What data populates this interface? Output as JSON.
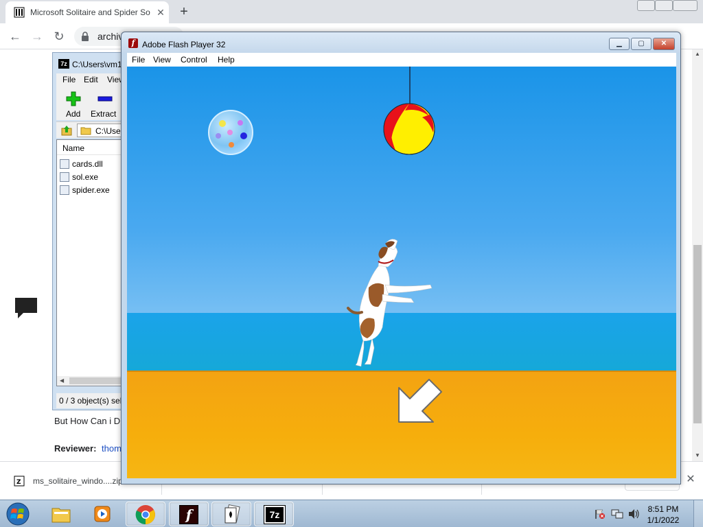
{
  "browser": {
    "tab_title": "Microsoft Solitaire and Spider So",
    "tab_close": "✕",
    "new_tab": "+",
    "omnibox_text": "archiv",
    "page": {
      "question_text": "But How Can i D",
      "reviewer_label": "Reviewer:",
      "reviewer_link": "thom"
    },
    "download_bar": {
      "items": [
        {
          "name": "ms_solitaire_windo....zip"
        },
        {
          "name": ""
        },
        {
          "name": ""
        }
      ],
      "close": "✕"
    }
  },
  "zip_window": {
    "title": "C:\\Users\\vm1",
    "icon_label": "7z",
    "menu": [
      "File",
      "Edit",
      "View"
    ],
    "toolbar": {
      "add_label": "Add",
      "extract_label": "Extract"
    },
    "address": "C:\\Use",
    "column_name": "Name",
    "files": [
      {
        "name": "cards.dll"
      },
      {
        "name": "sol.exe"
      },
      {
        "name": "spider.exe"
      }
    ],
    "status": "0 / 3 object(s) sele"
  },
  "flash_window": {
    "title": "Adobe Flash Player 32",
    "icon_label": "f",
    "menu": [
      "File",
      "View",
      "Control",
      "Help"
    ],
    "buttons": {
      "minimize": "▁",
      "maximize": "▢",
      "close": "✕"
    }
  },
  "taskbar": {
    "clock_time": "8:51 PM",
    "clock_date": "1/1/2022",
    "zip_label": "7z",
    "flash_label": "f"
  },
  "colors": {
    "sky_top": "#1a94e8",
    "sea": "#16a8d8",
    "sand": "#f6ae0c",
    "ball_red": "#e8121a",
    "ball_yellow": "#ffef00"
  }
}
